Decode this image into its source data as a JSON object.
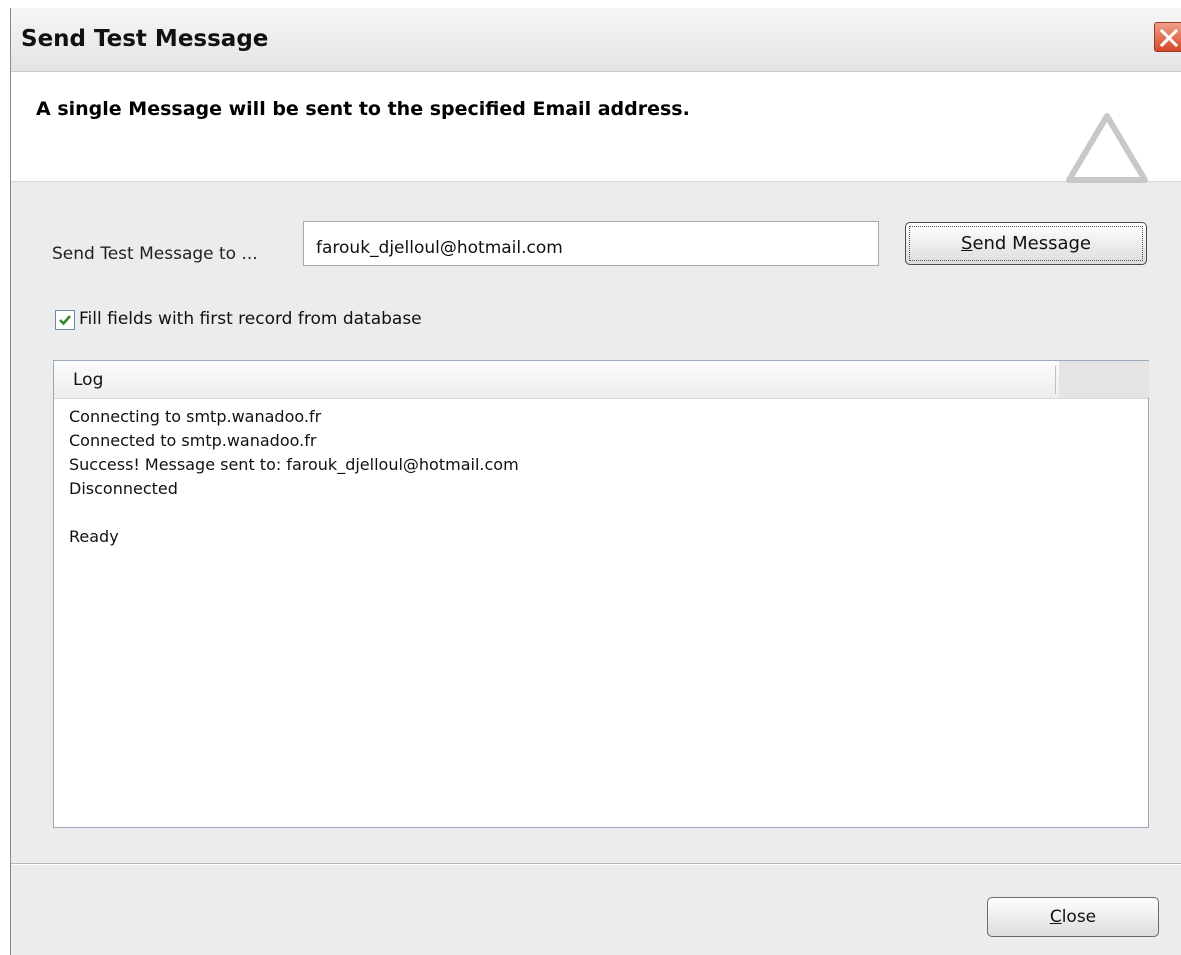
{
  "window": {
    "title": "Send Test Message"
  },
  "header": {
    "text": "A single Message will be sent to the specified Email address.",
    "icon": "triangle-outline-icon"
  },
  "form": {
    "label": "Send Test Message to ...",
    "email_value": "farouk_djelloul@hotmail.com",
    "send_button": {
      "prefix": "",
      "mnemonic": "S",
      "rest": "end Message"
    },
    "fill_fields": {
      "checked": true,
      "label": "Fill fields with first record from database"
    }
  },
  "log": {
    "column_header": "Log",
    "lines": [
      "Connecting to smtp.wanadoo.fr",
      "Connected to smtp.wanadoo.fr",
      "Success! Message sent to: farouk_djelloul@hotmail.com",
      "Disconnected",
      "",
      "Ready"
    ]
  },
  "footer": {
    "close_button": {
      "mnemonic": "C",
      "rest": "lose"
    }
  },
  "colors": {
    "close_x_bg": "#d5472a",
    "checkmark": "#2d8a2d",
    "window_bg": "#ececec"
  }
}
